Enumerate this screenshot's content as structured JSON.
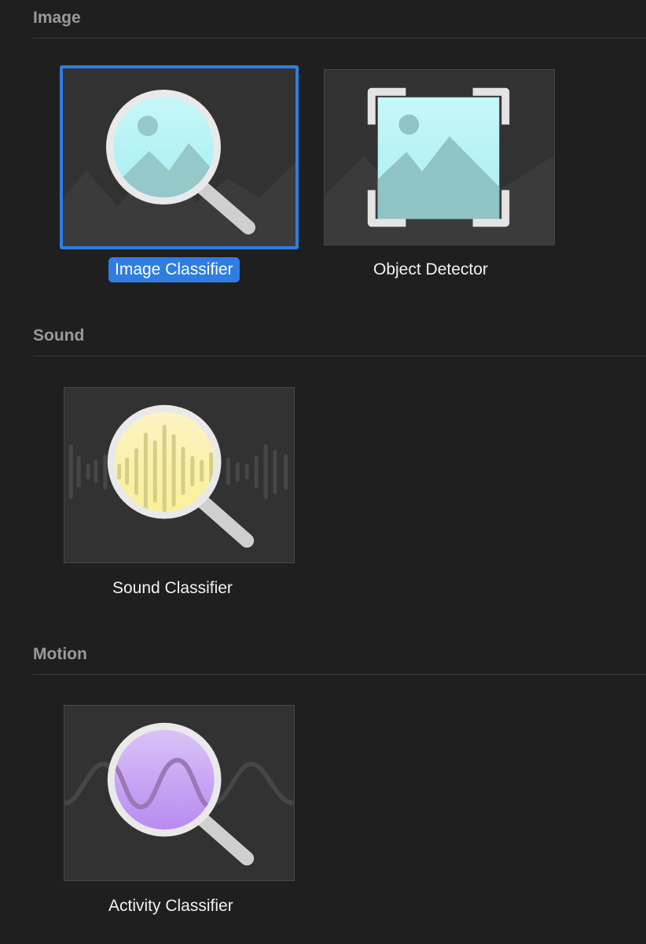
{
  "sections": [
    {
      "title": "Image",
      "templates": [
        {
          "label": "Image Classifier",
          "selected": true
        },
        {
          "label": "Object Detector",
          "selected": false
        }
      ]
    },
    {
      "title": "Sound",
      "templates": [
        {
          "label": "Sound Classifier",
          "selected": false
        }
      ]
    },
    {
      "title": "Motion",
      "templates": [
        {
          "label": "Activity Classifier",
          "selected": false
        }
      ]
    }
  ],
  "icons": {
    "image_classifier": "magnifier-landscape-icon",
    "object_detector": "bounding-box-landscape-icon",
    "sound_classifier": "magnifier-waveform-icon",
    "activity_classifier": "magnifier-sine-wave-icon"
  },
  "colors": {
    "background": "#1f1f1f",
    "tile_background": "#323232",
    "selection_accent": "#2f7de1",
    "section_header_text": "#9a9a9a",
    "label_text": "#f2f2f2",
    "image_lens": "#bff4f6",
    "sound_lens": "#fbf2a6",
    "motion_lens": "#c6a4f4"
  }
}
